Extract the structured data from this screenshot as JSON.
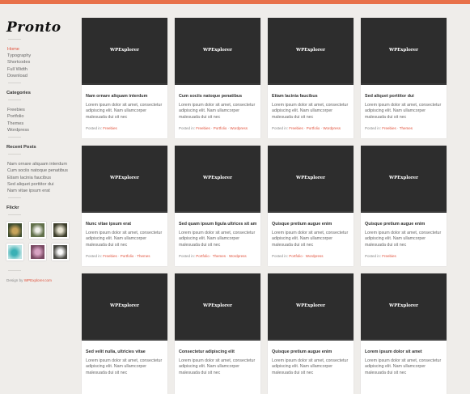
{
  "site": {
    "logo": "Pronto",
    "accent": "#e0503a",
    "topbar_color": "#e8714a"
  },
  "nav": [
    "Home",
    "Typography",
    "Shortcodes",
    "Full Width",
    "Download"
  ],
  "categories": {
    "title": "Categories",
    "items": [
      "Freebies",
      "Portfolio",
      "Themes",
      "Wordpress"
    ]
  },
  "recent_posts": {
    "title": "Recent Posts",
    "items": [
      "Nam ornare aliquam interdum",
      "Cum sociis natoque penatibus",
      "Etiam lacinia faucibus",
      "Sed aliquet porttitor dui",
      "Nam vitae ipsum erat"
    ]
  },
  "flickr": {
    "title": "Flickr",
    "icons": [
      "plant-photo",
      "flower-photo",
      "shell-photo",
      "teal-flower-photo",
      "pink-flower-photo",
      "white-flower-photo"
    ]
  },
  "footer_credit": {
    "prefix": "Design by",
    "link": "WPExplorer.com"
  },
  "posts": [
    {
      "image_label": "WPExplorer",
      "title": "Nam ornare aliquam interdum",
      "excerpt": "Lorem ipsum dolor sit amet, consectetur adipiscing elit. Nam ullamcorper malesuada dui sit nec",
      "meta_prefix": "Posted in:",
      "cats": [
        "Freebies"
      ]
    },
    {
      "image_label": "WPExplorer",
      "title": "Cum sociis natoque penatibus",
      "excerpt": "Lorem ipsum dolor sit amet, consectetur adipiscing elit. Nam ullamcorper malesuada dui sit nec",
      "meta_prefix": "Posted in:",
      "cats": [
        "Freebies",
        "Portfolio",
        "Wordpress"
      ]
    },
    {
      "image_label": "WPExplorer",
      "title": "Etiam lacinia faucibus",
      "excerpt": "Lorem ipsum dolor sit amet, consectetur adipiscing elit. Nam ullamcorper malesuada dui sit nec",
      "meta_prefix": "Posted in:",
      "cats": [
        "Freebies",
        "Portfolio",
        "Wordpress"
      ]
    },
    {
      "image_label": "WPExplorer",
      "title": "Sed aliquet porttitor dui",
      "excerpt": "Lorem ipsum dolor sit amet, consectetur adipiscing elit. Nam ullamcorper malesuada dui sit nec",
      "meta_prefix": "Posted in:",
      "cats": [
        "Freebies",
        "Themes"
      ]
    },
    {
      "image_label": "WPExplorer",
      "title": "Nunc vitae ipsum erat",
      "excerpt": "Lorem ipsum dolor sit amet, consectetur adipiscing elit. Nam ullamcorper malesuada dui sit nec",
      "meta_prefix": "Posted in:",
      "cats": [
        "Freebies",
        "Portfolio",
        "Themes"
      ]
    },
    {
      "image_label": "WPExplorer",
      "title": "Sed quam ipsum ligula ultrices sit amet",
      "excerpt": "Lorem ipsum dolor sit amet, consectetur adipiscing elit. Nam ullamcorper malesuada dui sit nec",
      "meta_prefix": "Posted in:",
      "cats": [
        "Portfolio",
        "Themes",
        "Wordpress"
      ]
    },
    {
      "image_label": "WPExplorer",
      "title": "Quisque pretium augue enim",
      "excerpt": "Lorem ipsum dolor sit amet, consectetur adipiscing elit. Nam ullamcorper malesuada dui sit nec",
      "meta_prefix": "Posted in:",
      "cats": [
        "Portfolio",
        "Wordpress"
      ]
    },
    {
      "image_label": "WPExplorer",
      "title": "Quisque pretium augue enim",
      "excerpt": "Lorem ipsum dolor sit amet, consectetur adipiscing elit. Nam ullamcorper malesuada dui sit nec",
      "meta_prefix": "Posted in:",
      "cats": [
        "Freebies"
      ]
    },
    {
      "image_label": "WPExplorer",
      "title": "Sed velit nulla, ultricies vitae",
      "excerpt": "Lorem ipsum dolor sit amet, consectetur adipiscing elit. Nam ullamcorper malesuada dui sit nec",
      "meta_prefix": "",
      "cats": []
    },
    {
      "image_label": "WPExplorer",
      "title": "Consectetur adipiscing elit",
      "excerpt": "Lorem ipsum dolor sit amet, consectetur adipiscing elit. Nam ullamcorper malesuada dui sit nec",
      "meta_prefix": "",
      "cats": []
    },
    {
      "image_label": "WPExplorer",
      "title": "Quisque pretium augue enim",
      "excerpt": "Lorem ipsum dolor sit amet, consectetur adipiscing elit. Nam ullamcorper malesuada dui sit nec",
      "meta_prefix": "",
      "cats": []
    },
    {
      "image_label": "WPExplorer",
      "title": "Lorem ipsum dolor sit amet",
      "excerpt": "Lorem ipsum dolor sit amet, consectetur adipiscing elit. Nam ullamcorper malesuada dui sit nec",
      "meta_prefix": "",
      "cats": []
    }
  ]
}
